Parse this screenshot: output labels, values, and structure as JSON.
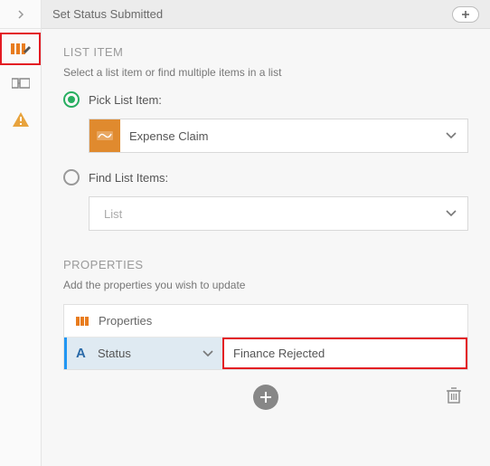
{
  "title": "Set Status Submitted",
  "list_item": {
    "heading": "LIST ITEM",
    "subheading": "Select a list item or find multiple items in a list",
    "pick_label": "Pick List Item:",
    "pick_value": "Expense Claim",
    "find_label": "Find List Items:",
    "find_placeholder": "List"
  },
  "properties": {
    "heading": "PROPERTIES",
    "subheading": "Add the properties you wish to update",
    "header_label": "Properties",
    "row": {
      "key": "Status",
      "value": "Finance Rejected"
    }
  }
}
